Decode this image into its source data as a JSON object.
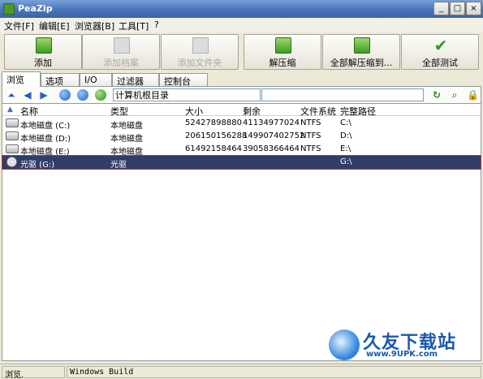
{
  "window": {
    "title": "PeaZip",
    "min": "_",
    "max": "□",
    "close": "×"
  },
  "menu": [
    "文件[F]",
    "编辑[E]",
    "浏览器[B]",
    "工具[T]",
    "?"
  ],
  "toolbar": [
    {
      "label": "添加",
      "enabled": true,
      "icon": "add-icon"
    },
    {
      "label": "添加档案",
      "enabled": false,
      "icon": "add-archive-icon"
    },
    {
      "label": "添加文件夹",
      "enabled": false,
      "icon": "add-folder-icon"
    },
    {
      "label": "解压缩",
      "enabled": true,
      "icon": "extract-icon"
    },
    {
      "label": "全部解压缩到...",
      "enabled": true,
      "icon": "extract-all-icon"
    },
    {
      "label": "全部测试",
      "enabled": true,
      "icon": "check-icon"
    }
  ],
  "tabs": [
    {
      "label": "浏览",
      "active": true
    },
    {
      "label": "选项",
      "active": false
    },
    {
      "label": "I/O",
      "active": false
    },
    {
      "label": "过滤器",
      "active": false
    },
    {
      "label": "控制台",
      "active": false
    }
  ],
  "nav": {
    "path": "计算机根目录",
    "up": "⏶",
    "back": "◀",
    "forward": "▶",
    "refresh": "↻",
    "search": "⌕",
    "lock": "🔒"
  },
  "columns": [
    "名称",
    "类型",
    "大小",
    "剩余",
    "文件系统",
    "完整路径"
  ],
  "rows": [
    {
      "name": "本地磁盘 (C:)",
      "type": "本地磁盘",
      "size": "52427898880",
      "free": "41134977024",
      "fs": "NTFS",
      "path": "C:\\",
      "icon": "drive-icon",
      "selected": false
    },
    {
      "name": "本地磁盘 (D:)",
      "type": "本地磁盘",
      "size": "206150156288",
      "free": "149907402752",
      "fs": "NTFS",
      "path": "D:\\",
      "icon": "drive-icon",
      "selected": false
    },
    {
      "name": "本地磁盘 (E:)",
      "type": "本地磁盘",
      "size": "61492158464",
      "free": "39058366464",
      "fs": "NTFS",
      "path": "E:\\",
      "icon": "drive-icon",
      "selected": false
    },
    {
      "name": "光驱 (G:)",
      "type": "光驱",
      "size": "",
      "free": "",
      "fs": "",
      "path": "G:\\",
      "icon": "cd-icon",
      "selected": true
    }
  ],
  "status": {
    "left": "浏览.",
    "right": "Windows Build"
  },
  "watermark": {
    "text": "久友下载站",
    "url": "www.9UPK.com"
  }
}
